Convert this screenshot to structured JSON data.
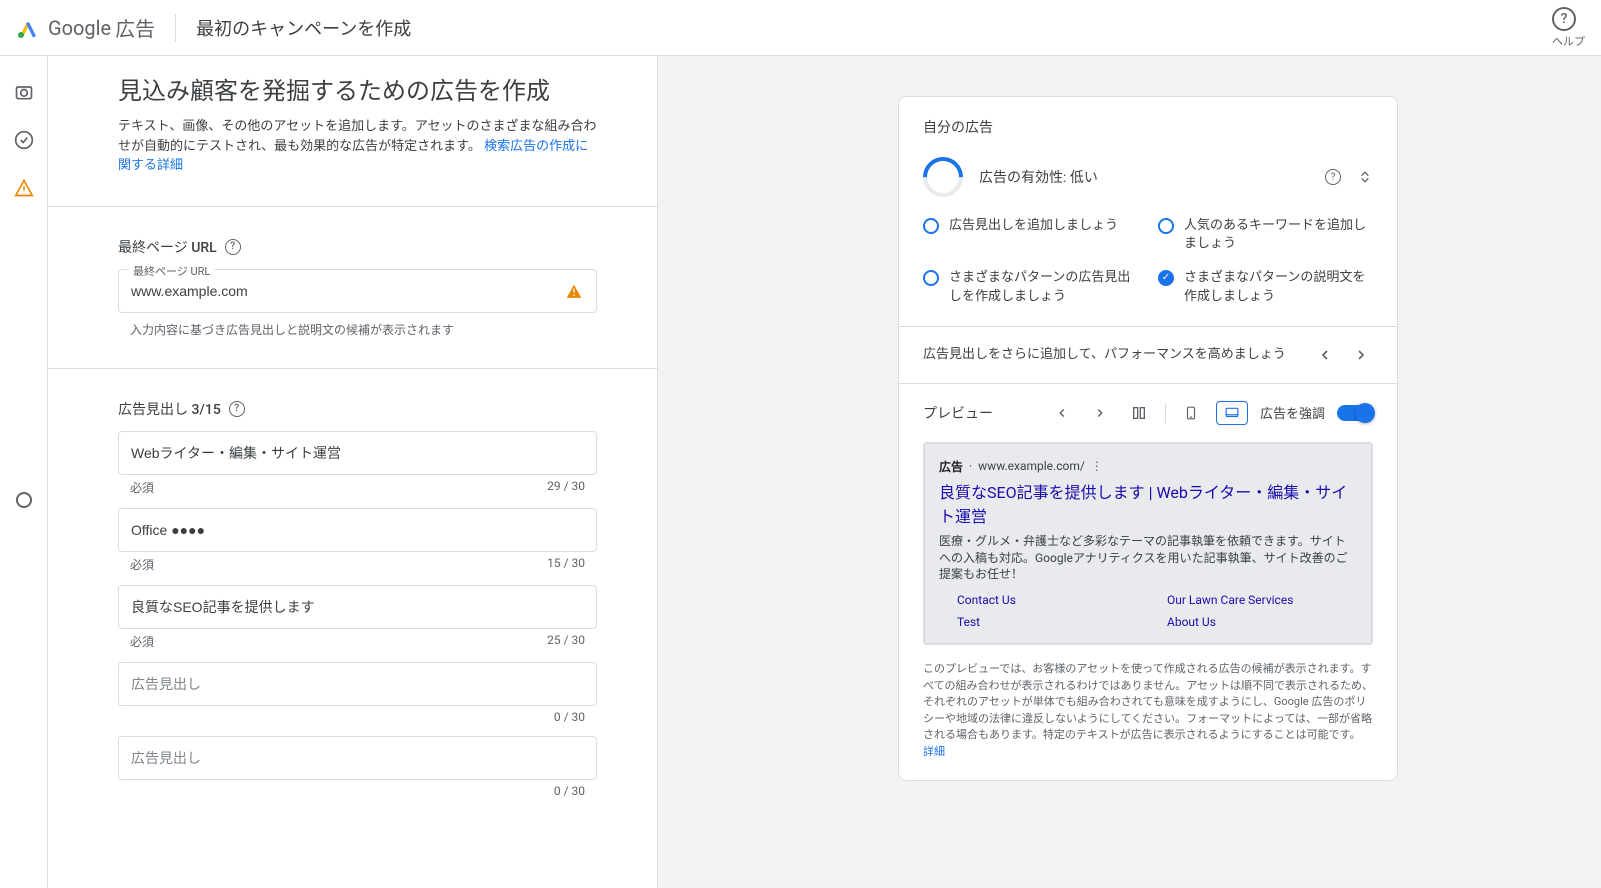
{
  "header": {
    "logo_text": "Google",
    "logo_suffix": "広告",
    "title": "最初のキャンペーンを作成",
    "help_label": "ヘルプ"
  },
  "page": {
    "heading": "見込み顧客を発掘するための広告を作成",
    "description_a": "テキスト、画像、その他のアセットを追加します。アセットのさまざまな組み合わせが自動的にテストされ、最も効果的な広告が特定されます。",
    "description_link": "検索広告の作成に関する詳細"
  },
  "final_url": {
    "label": "最終ページ URL",
    "float_label": "最終ページ URL",
    "value": "www.example.com",
    "help_text": "入力内容に基づき広告見出しと説明文の候補が表示されます"
  },
  "headlines": {
    "label": "広告見出し 3/15",
    "required_text": "必須",
    "items": [
      {
        "value": "Webライター・編集・サイト運営",
        "count": "29 / 30"
      },
      {
        "value": "Office ●●●●",
        "count": "15 / 30"
      },
      {
        "value": "良質なSEO記事を提供します",
        "count": "25 / 30"
      },
      {
        "value": "",
        "placeholder": "広告見出し",
        "count": "0 / 30"
      },
      {
        "value": "",
        "placeholder": "広告見出し",
        "count": "0 / 30"
      }
    ]
  },
  "right_panel": {
    "title": "自分の広告",
    "strength_label": "広告の有効性: 低い",
    "checks": [
      {
        "text": "広告見出しを追加しましょう",
        "done": false
      },
      {
        "text": "人気のあるキーワードを追加しましょう",
        "done": false
      },
      {
        "text": "さまざまなパターンの広告見出しを作成しましょう",
        "done": false
      },
      {
        "text": "さまざまなパターンの説明文を作成しましょう",
        "done": true
      }
    ],
    "tip": "広告見出しをさらに追加して、パフォーマンスを高めましょう",
    "preview_label": "プレビュー",
    "emphasize_label": "広告を強調",
    "ad": {
      "badge": "広告",
      "url": "www.example.com/",
      "headline": "良質なSEO記事を提供します | Webライター・編集・サイト運営",
      "desc": "医療・グルメ・弁護士など多彩なテーマの記事執筆を依頼できます。サイトへの入稿も対応。Googleアナリティクスを用いた記事執筆、サイト改善のご提案もお任せ！",
      "sitelinks": [
        "Contact Us",
        "Our Lawn Care Services",
        "Test",
        "About Us"
      ]
    },
    "disclaimer": "このプレビューでは、お客様のアセットを使って作成される広告の候補が表示されます。すべての組み合わせが表示されるわけではありません。アセットは順不同で表示されるため、それぞれのアセットが単体でも組み合わされても意味を成すようにし、Google 広告のポリシーや地域の法律に違反しないようにしてください。フォーマットによっては、一部が省略される場合もあります。特定のテキストが広告に表示されるようにすることは可能です。",
    "disclaimer_link": "詳細"
  }
}
